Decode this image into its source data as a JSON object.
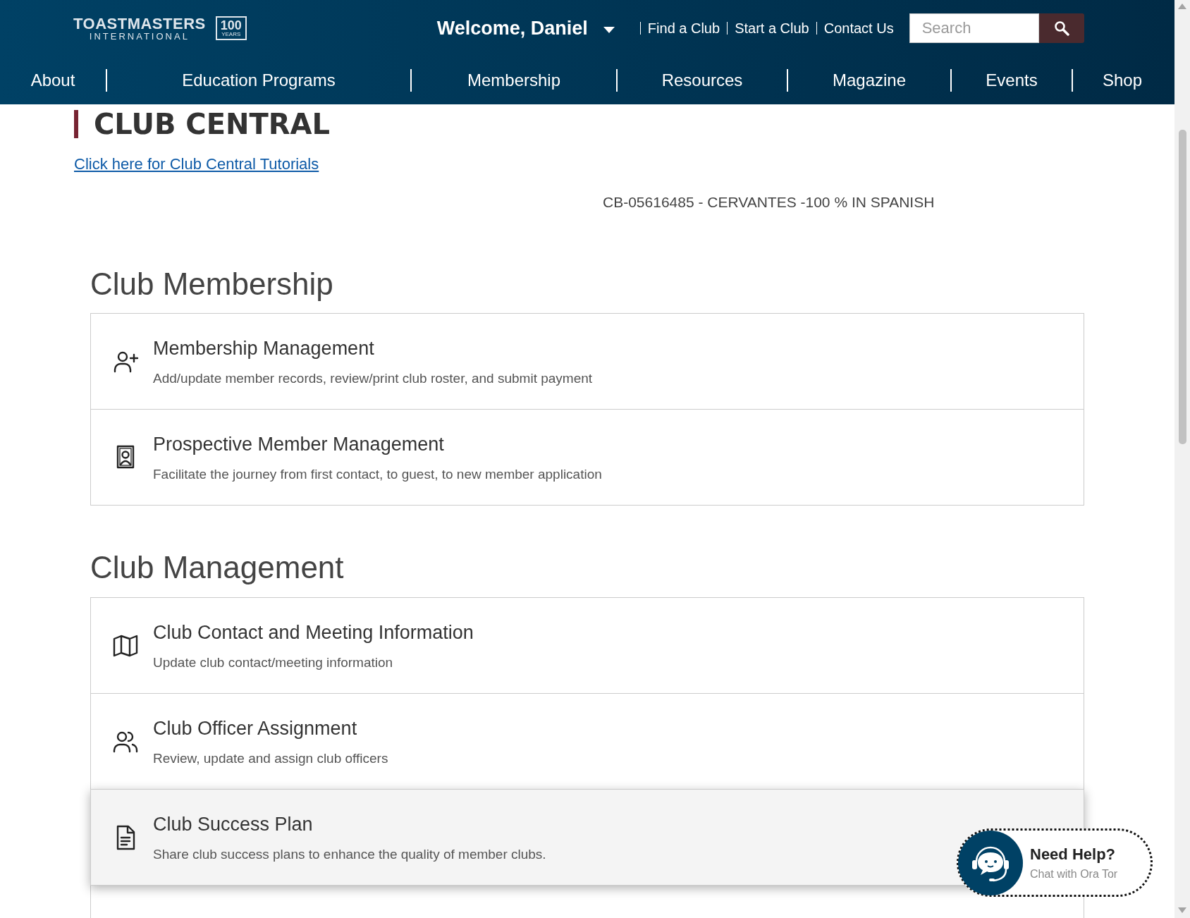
{
  "header": {
    "logo": {
      "name": "TOASTMASTERS",
      "sub": "INTERNATIONAL",
      "badge_number": "100",
      "badge_label": "YEARS"
    },
    "welcome": "Welcome, Daniel",
    "utility_links": [
      "Find a Club",
      "Start a Club",
      "Contact Us"
    ],
    "search": {
      "placeholder": "Search"
    },
    "nav": [
      "About",
      "Education Programs",
      "Membership",
      "Resources",
      "Magazine",
      "Events",
      "Shop"
    ]
  },
  "page_title": "CLUB CENTRAL",
  "tutorial_link": "Click here for Club Central Tutorials",
  "club_id": "CB-05616485 - CERVANTES -100 % IN SPANISH",
  "sections": [
    {
      "title": "Club Membership",
      "cards": [
        {
          "kind": "person-add",
          "title": "Membership Management",
          "description": "Add/update member records, review/print club roster, and submit payment",
          "hovered": false
        },
        {
          "kind": "portrait",
          "title": "Prospective Member Management",
          "description": "Facilitate the journey from first contact, to guest, to new member application",
          "hovered": false
        }
      ]
    },
    {
      "title": "Club Management",
      "cards": [
        {
          "kind": "map",
          "title": "Club Contact and Meeting Information",
          "description": "Update club contact/meeting information",
          "hovered": false
        },
        {
          "kind": "people",
          "title": "Club Officer Assignment",
          "description": "Review, update and assign club officers",
          "hovered": false
        },
        {
          "kind": "document",
          "title": "Club Success Plan",
          "description": "Share club success plans to enhance the quality of member clubs.",
          "hovered": true
        },
        {
          "kind": "blank"
        }
      ]
    }
  ],
  "chat": {
    "title": "Need Help?",
    "subtitle": "Chat with Ora Tor"
  }
}
